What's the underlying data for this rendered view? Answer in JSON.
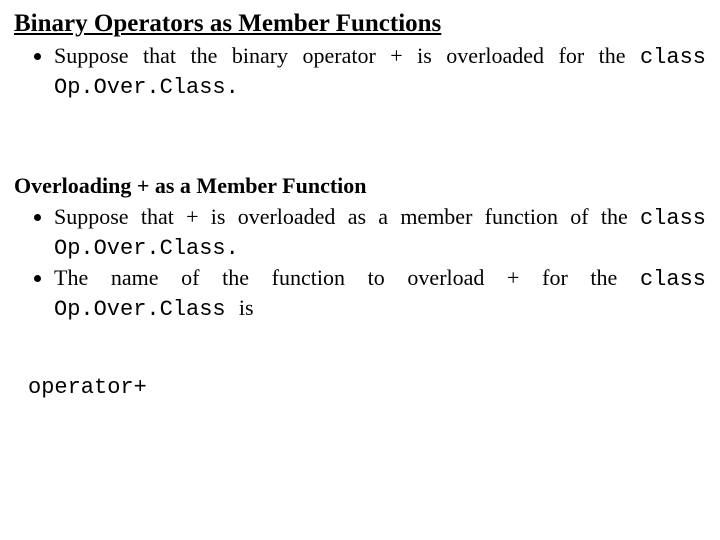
{
  "title": "Binary Operators as Member Functions",
  "section1": {
    "items": [
      {
        "pre": "Suppose that the binary operator + is overloaded for the ",
        "kw": "class",
        "post_code": " Op.Over.Class.",
        "tail": ""
      }
    ]
  },
  "subheading": "Overloading + as a Member Function",
  "section2": {
    "items": [
      {
        "pre": "Suppose that + is overloaded as a member function of the ",
        "kw": "class",
        "post_code": " Op.Over.Class.",
        "tail": ""
      },
      {
        "pre": "The name of the function to overload + for the ",
        "kw": "class",
        "post_code": " Op.Over.Class ",
        "tail": "is"
      }
    ]
  },
  "codeline": "operator+"
}
